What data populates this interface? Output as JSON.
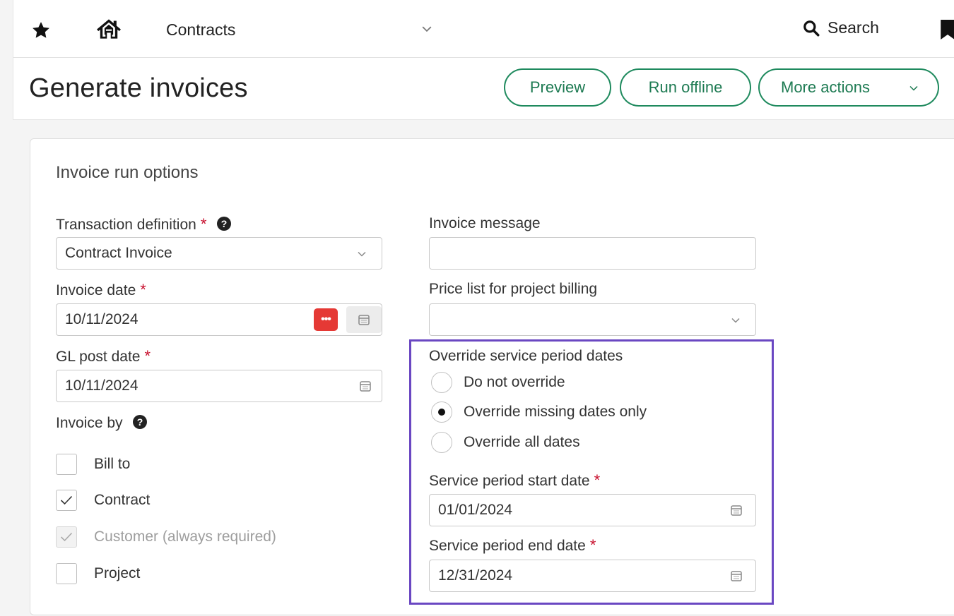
{
  "topbar": {
    "module": "Contracts",
    "search_label": "Search"
  },
  "page": {
    "title": "Generate invoices"
  },
  "actions": {
    "preview": "Preview",
    "run_offline": "Run offline",
    "more_actions": "More actions"
  },
  "form": {
    "section_title": "Invoice run options",
    "transaction_definition": {
      "label": "Transaction definition",
      "value": "Contract Invoice"
    },
    "invoice_date": {
      "label": "Invoice date",
      "value": "10/11/2024"
    },
    "gl_post_date": {
      "label": "GL post date",
      "value": "10/11/2024"
    },
    "invoice_by": {
      "label": "Invoice by",
      "options": [
        {
          "label": "Bill to",
          "checked": false,
          "disabled": false
        },
        {
          "label": "Contract",
          "checked": true,
          "disabled": false
        },
        {
          "label": "Customer (always required)",
          "checked": true,
          "disabled": true
        },
        {
          "label": "Project",
          "checked": false,
          "disabled": false
        }
      ]
    },
    "invoice_message": {
      "label": "Invoice message",
      "value": ""
    },
    "price_list": {
      "label": "Price list for project billing",
      "value": ""
    },
    "override": {
      "label": "Override service period dates",
      "options": [
        {
          "label": "Do not override",
          "selected": false
        },
        {
          "label": "Override missing dates only",
          "selected": true
        },
        {
          "label": "Override all dates",
          "selected": false
        }
      ],
      "highlight_color": "#6a47c2"
    },
    "service_start": {
      "label": "Service period start date",
      "value": "01/01/2024"
    },
    "service_end": {
      "label": "Service period end date",
      "value": "12/31/2024"
    },
    "required_marker": "*"
  },
  "colors": {
    "accent": "#1f8a5e",
    "required": "#c8102e",
    "highlight": "#6a47c2",
    "dots_button": "#e53935"
  }
}
